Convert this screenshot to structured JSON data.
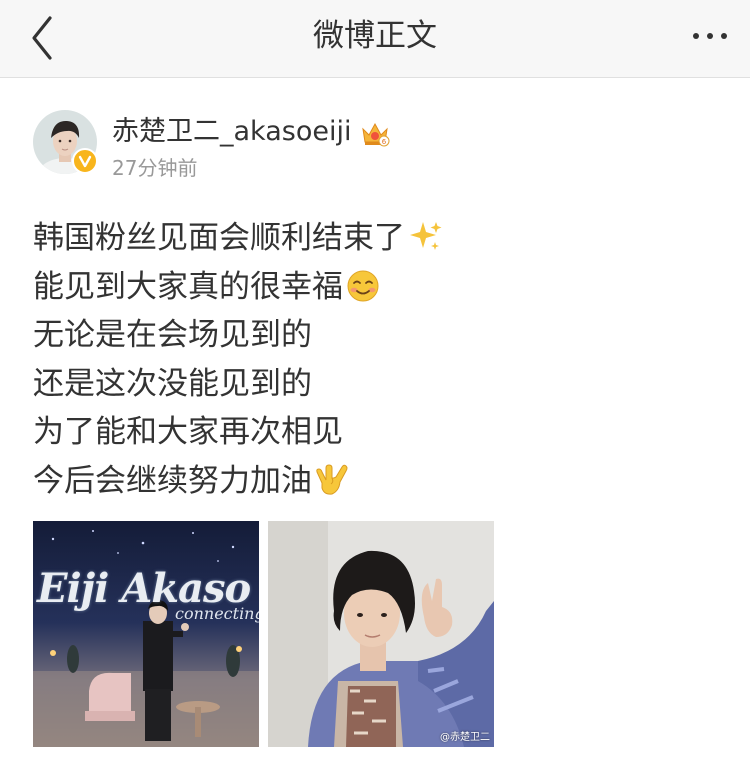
{
  "navbar": {
    "title": "微博正文",
    "back_icon": "chevron-left-icon",
    "more_icon": "more-dots-icon"
  },
  "post": {
    "author": "赤楚卫二_akasoeiji",
    "time": "27分钟前",
    "lines": [
      "韩国粉丝见面会顺利结束了",
      "能见到大家真的很幸福",
      "无论是在会场见到的",
      "还是这次没能见到的",
      "为了能和大家再次相见",
      "今后会继续努力加油"
    ],
    "emojis": {
      "line1": "sparkles-emoji",
      "line2": "smiling-face-emoji",
      "line6": "love-you-gesture-emoji"
    },
    "photos": [
      {
        "poster_title": "Eiji Akaso",
        "poster_subtitle": "connecting"
      },
      {
        "watermark": "@赤楚卫二"
      }
    ]
  },
  "colors": {
    "navbar_bg": "#f7f7f7",
    "text": "#333333",
    "secondary_text": "#999999",
    "verified": "#f8b51c"
  }
}
